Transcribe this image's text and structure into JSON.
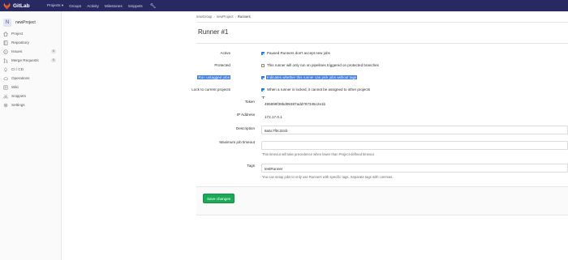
{
  "brand": {
    "name": "GitLab",
    "logo_color": "#fc6d26"
  },
  "navbar": {
    "items": [
      "Projects ▾",
      "Groups",
      "Activity",
      "Milestones",
      "Snippets"
    ],
    "wrench_icon": "wrench-icon"
  },
  "sidebar": {
    "avatar_letter": "N",
    "project_name": "newProject",
    "items": [
      {
        "label": "Project",
        "icon": "home-icon"
      },
      {
        "label": "Repository",
        "icon": "book-icon"
      },
      {
        "label": "Issues",
        "icon": "issues-icon",
        "badge": "0"
      },
      {
        "label": "Merge Requests",
        "icon": "merge-request-icon",
        "badge": "0"
      },
      {
        "label": "CI / CD",
        "icon": "rocket-icon"
      },
      {
        "label": "Operations",
        "icon": "cloud-gear-icon"
      },
      {
        "label": "Wiki",
        "icon": "wiki-icon"
      },
      {
        "label": "Snippets",
        "icon": "snippet-icon"
      },
      {
        "label": "Settings",
        "icon": "gear-icon"
      }
    ]
  },
  "breadcrumb": [
    "newGroup",
    "newProject",
    "Runners"
  ],
  "page": {
    "title": "Runner #1"
  },
  "form": {
    "active": {
      "label": "Active",
      "checked": true,
      "text": "Paused Runners don't accept new jobs"
    },
    "protected": {
      "label": "Protected",
      "checked": false,
      "text": "This runner will only run on pipelines triggered on protected branches"
    },
    "run_untagged": {
      "label": "Run untagged jobs",
      "checked": true,
      "text": "Indicates whether this runner can pick jobs without tags"
    },
    "locked": {
      "label": "Lock to current projects",
      "checked": true,
      "text": "When a runner is locked, it cannot be assigned to other projects"
    },
    "token": {
      "label": "Token",
      "value": "495899f39bd95387add787345c2e1b"
    },
    "ip_address": {
      "label": "IP Address",
      "value": "172.17.0.1"
    },
    "description": {
      "label": "Description",
      "value": "8a5c7f0c32cb"
    },
    "max_timeout": {
      "label": "Maximum job timeout",
      "value": "",
      "help": "This timeout will take precedence when lower than Project-defined timeout"
    },
    "tags": {
      "label": "Tags",
      "value": "testRunner",
      "help": "You can setup jobs to only use Runners with specific tags. Separate tags with commas."
    },
    "save_label": "Save changes"
  }
}
